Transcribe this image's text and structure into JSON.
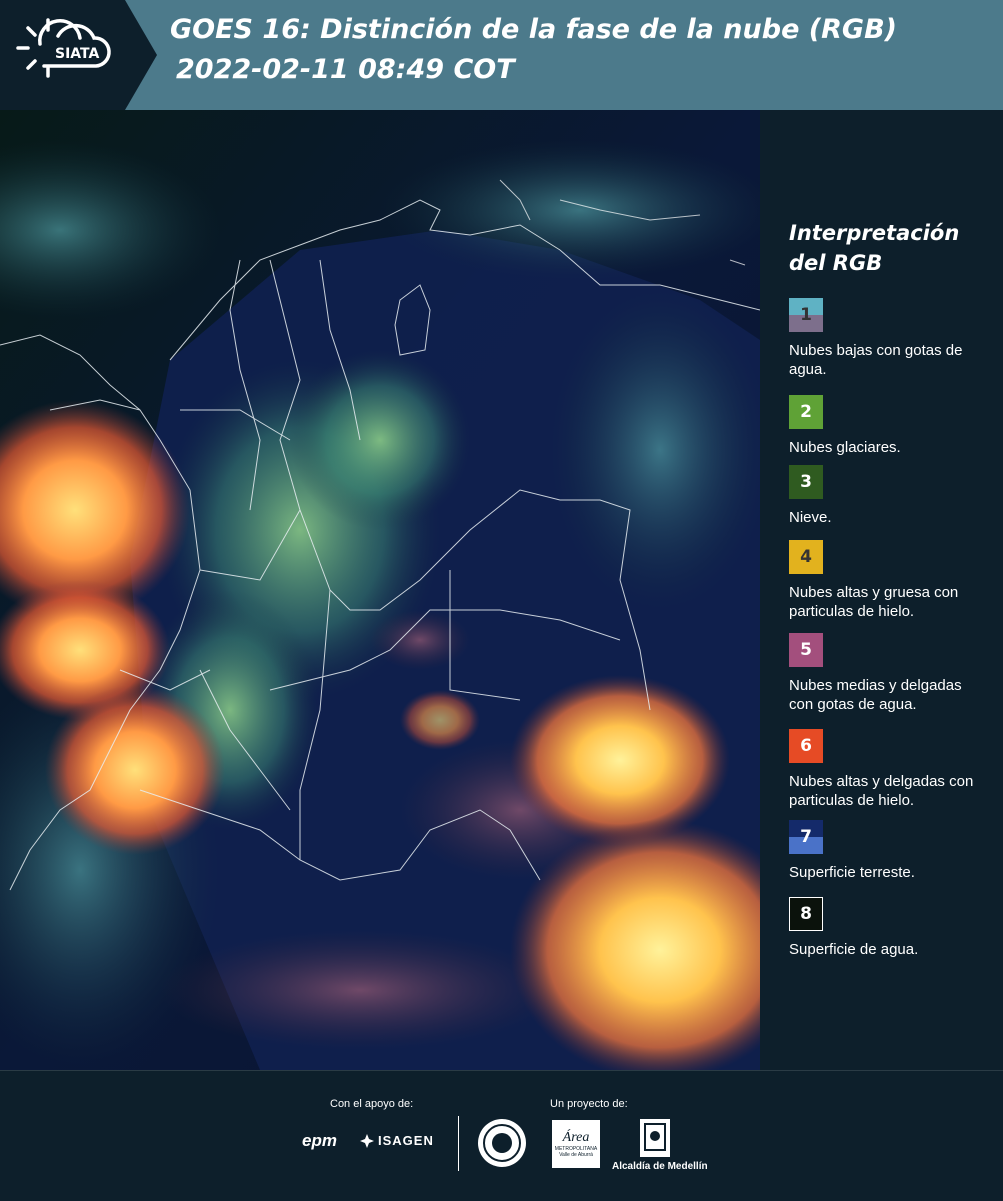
{
  "header": {
    "logo_text": "SIATA",
    "title_line1": "GOES 16: Distinción de la fase de la nube (RGB)",
    "title_line2": "2022-02-11 08:49 COT"
  },
  "legend": {
    "title_line1": "Interpretación",
    "title_line2": "del RGB",
    "items": [
      {
        "number": "1",
        "label": "Nubes bajas con gotas de agua.",
        "color_top": "#5fb2c4",
        "color_bottom": "#7d6f8c"
      },
      {
        "number": "2",
        "label": "Nubes glaciares.",
        "color_top": "#5fa236",
        "color_bottom": "#5fa236"
      },
      {
        "number": "3",
        "label": "Nieve.",
        "color_top": "#2f5b20",
        "color_bottom": "#2f5b20"
      },
      {
        "number": "4",
        "label": "Nubes altas y gruesa con particulas de hielo.",
        "color_top": "#e2b21e",
        "color_bottom": "#e2b21e"
      },
      {
        "number": "5",
        "label": "Nubes medias y delgadas con gotas de agua.",
        "color_top": "#a34f7d",
        "color_bottom": "#a34f7d"
      },
      {
        "number": "6",
        "label": "Nubes altas y delgadas con particulas de hielo.",
        "color_top": "#e64b25",
        "color_bottom": "#e64b25"
      },
      {
        "number": "7",
        "label": "Superficie terreste.",
        "color_top": "#142a6a",
        "color_bottom": "#4a72c8"
      },
      {
        "number": "8",
        "label": "Superficie de agua.",
        "color_top": "#0b120c",
        "color_bottom": "#0b120c"
      }
    ]
  },
  "footer": {
    "support_label": "Con el apoyo de:",
    "project_label": "Un proyecto de:",
    "logo_epm": "epm",
    "logo_isagen": "ISAGEN",
    "logo_area": "Área",
    "logo_area_sub": "METROPOLITANA",
    "logo_area_sub2": "Valle de Aburrá",
    "logo_alcaldia": "Alcaldía de Medellín"
  }
}
